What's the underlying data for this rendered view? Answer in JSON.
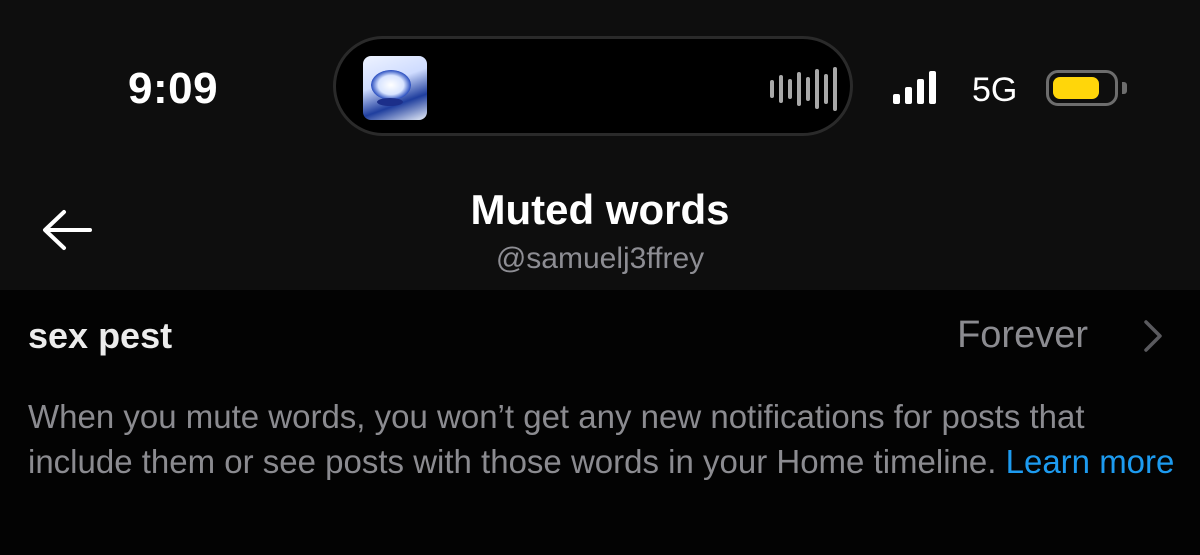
{
  "status_bar": {
    "time": "9:09",
    "network": "5G",
    "signal_bars": 4,
    "battery_level": 0.8,
    "battery_color": "#ffd60a",
    "now_playing": {
      "artwork_icon": "album-art",
      "activity_icon": "audio-waveform-icon"
    }
  },
  "header": {
    "back_icon": "arrow-left-icon",
    "title": "Muted words",
    "handle": "@samuelj3ffrey"
  },
  "muted_words": [
    {
      "word": "sex pest",
      "duration": "Forever",
      "chevron_icon": "chevron-right-icon"
    }
  ],
  "description": {
    "text": "When you mute words, you won’t get any new notifications for posts that include them or see posts with those words in your Home timeline.",
    "link_label": "Learn more",
    "link_color": "#1d9bf0"
  }
}
